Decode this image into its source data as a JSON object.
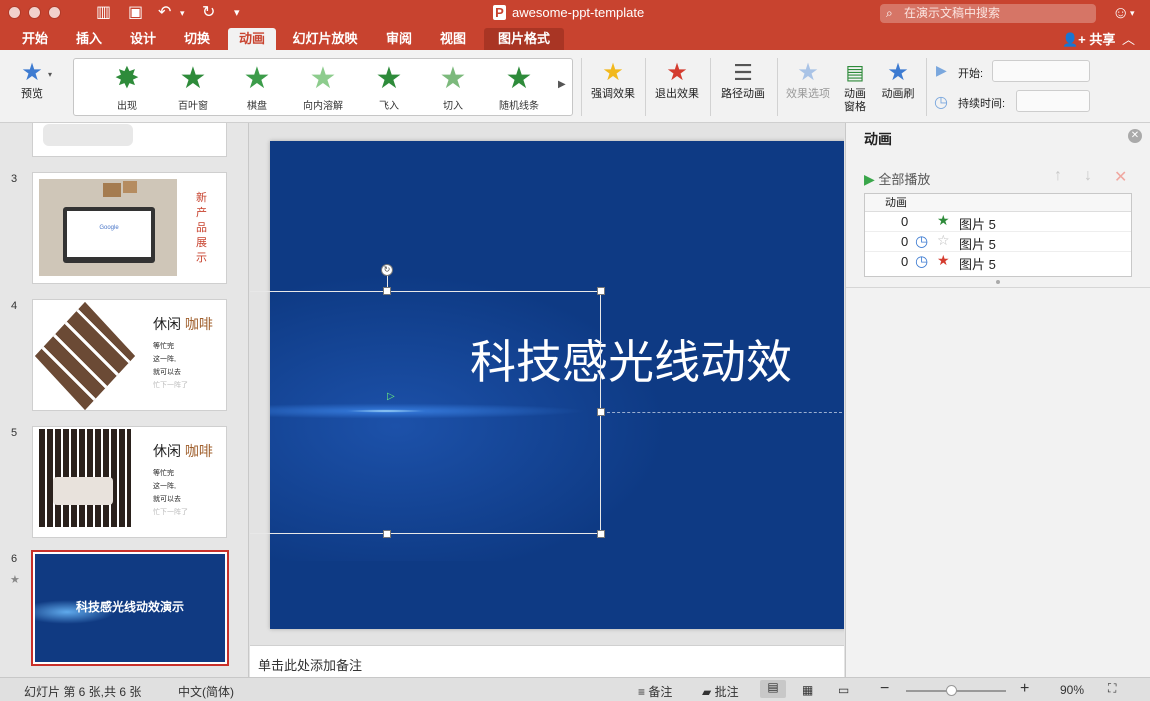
{
  "window": {
    "title": "awesome-ppt-template",
    "search_placeholder": "在演示文稿中搜索"
  },
  "tabs": [
    {
      "label": "开始"
    },
    {
      "label": "插入"
    },
    {
      "label": "设计"
    },
    {
      "label": "切换"
    },
    {
      "label": "动画"
    },
    {
      "label": "幻灯片放映"
    },
    {
      "label": "审阅"
    },
    {
      "label": "视图"
    },
    {
      "label": "图片格式"
    }
  ],
  "share_label": "共享",
  "ribbon": {
    "preview_label": "预览",
    "effects": [
      {
        "label": "出现",
        "color": "#2e8b3a"
      },
      {
        "label": "百叶窗",
        "color": "#2e8b3a"
      },
      {
        "label": "棋盘",
        "color": "#3c9c4a"
      },
      {
        "label": "向内溶解",
        "color": "#6bbf6b"
      },
      {
        "label": "飞入",
        "color": "#2e8b3a"
      },
      {
        "label": "切入",
        "color": "#5aaa5a"
      },
      {
        "label": "随机线条",
        "color": "#2e8b3a"
      }
    ],
    "emphasis_label": "强调效果",
    "exit_label": "退出效果",
    "path_label": "路径动画",
    "options_label": "效果选项",
    "pane_label_1": "动画",
    "pane_label_2": "窗格",
    "painter_label": "动画刷",
    "start_label": "开始:",
    "duration_label": "持续时间:"
  },
  "slides": [
    {
      "num": "3",
      "side_text": "新产品展示",
      "google": "Google"
    },
    {
      "num": "4",
      "title_a": "休闲",
      "title_b": "咖啡",
      "line1": "等忙完",
      "line2": "这一阵,",
      "line3": "就可以去",
      "line4": "忙下一阵了"
    },
    {
      "num": "5",
      "title_a": "休闲",
      "title_b": "咖啡",
      "line1": "等忙完",
      "line2": "这一阵,",
      "line3": "就可以去",
      "line4": "忙下一阵了"
    },
    {
      "num": "6",
      "title": "科技感光线动效演示"
    }
  ],
  "canvas": {
    "title": "科技感光线动效"
  },
  "notes_placeholder": "单击此处添加备注",
  "pane": {
    "title": "动画",
    "play_all": "全部播放",
    "list_header": "动画",
    "rows": [
      {
        "order": "0",
        "name": "图片 5",
        "star_color": "#2e8b3a"
      },
      {
        "order": "0",
        "name": "图片 5",
        "star_color": "#2e8b3a"
      },
      {
        "order": "0",
        "name": "图片 5",
        "star_color": "#d43c2f"
      }
    ]
  },
  "status": {
    "slide_info": "幻灯片 第 6 张,共 6 张",
    "language": "中文(简体)",
    "notes": "备注",
    "comments": "批注",
    "zoom": "90%",
    "zoom_level": 0.45
  }
}
